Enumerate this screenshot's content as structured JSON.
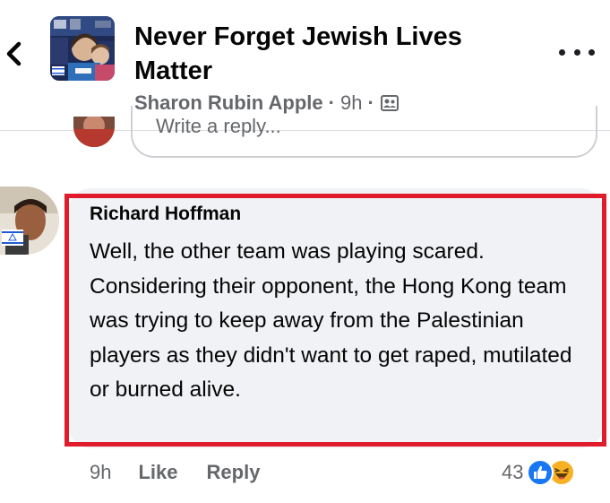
{
  "header": {
    "group_title": "Never Forget Jewish Lives Matter",
    "author": "Sharon Rubin Apple",
    "time": "9h",
    "sep1": "·",
    "sep2": "·",
    "back_icon": "chevron-left-icon",
    "more_icon": "more-horizontal-icon",
    "privacy_icon": "group-privacy-icon"
  },
  "reply": {
    "placeholder": "Write a reply..."
  },
  "comment": {
    "author": "Richard Hoffman",
    "text": "Well, the other team was playing scared. Considering their opponent, the Hong Kong team was trying to keep away from the Palestinian players as they didn't want to get raped, mutilated or burned alive.",
    "time": "9h",
    "like_label": "Like",
    "reply_label": "Reply",
    "reaction_count": "43",
    "reaction_icons": [
      "like-reaction-icon",
      "haha-reaction-icon"
    ]
  },
  "colors": {
    "highlight": "#e01b2b",
    "bubble": "#f0f2f5",
    "secondary_text": "#65676b",
    "like_blue": "#1877f2",
    "haha_yellow": "#f7b125"
  }
}
